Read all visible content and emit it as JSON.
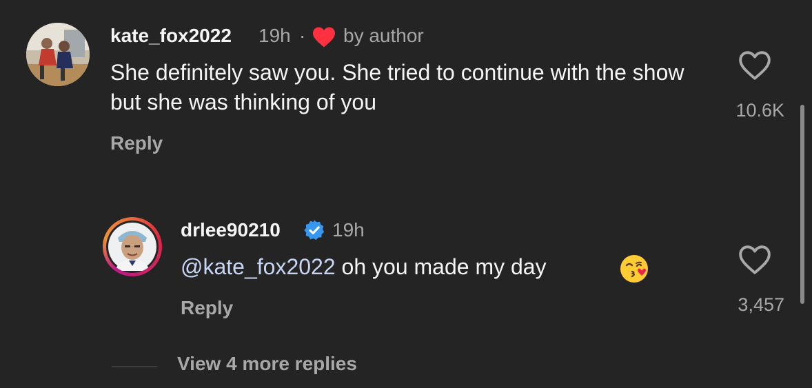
{
  "comment": {
    "username": "kate_fox2022",
    "time": "19h",
    "separator": "·",
    "author_badge": "by author",
    "text": "She definitely saw you. She tried to continue with the show but she was thinking of you",
    "reply_label": "Reply",
    "like_count": "10.6K",
    "avatar_icon": "profile-photo",
    "heart_color": "#ff3040"
  },
  "reply": {
    "username": "drlee90210",
    "verified_icon": "verified-badge-icon",
    "time": "19h",
    "mention": "@kate_fox2022",
    "text": " oh you made my day",
    "emoji": "😘",
    "reply_label": "Reply",
    "like_count": "3,457"
  },
  "thread": {
    "more_replies": "View 4 more replies"
  }
}
